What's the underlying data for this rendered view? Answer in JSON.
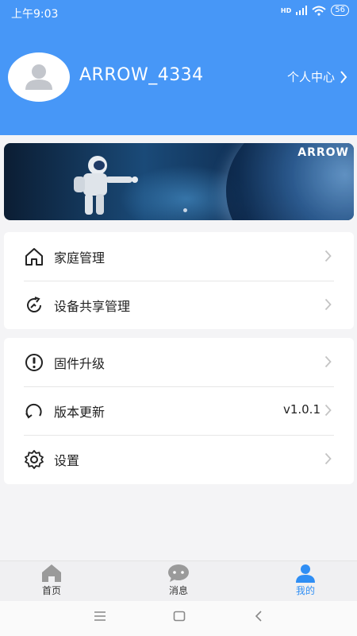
{
  "status_bar": {
    "time": "上午9:03",
    "network": "HD",
    "battery": "56"
  },
  "profile": {
    "username": "ARROW_4334",
    "center_link": "个人中心"
  },
  "banner": {
    "logo_text": "ARROW"
  },
  "menu_group_1": [
    {
      "label": "家庭管理",
      "icon": "home-icon"
    },
    {
      "label": "设备共享管理",
      "icon": "share-icon"
    }
  ],
  "menu_group_2": [
    {
      "label": "固件升级",
      "icon": "firmware-icon"
    },
    {
      "label": "版本更新",
      "icon": "update-icon",
      "value": "v1.0.1"
    },
    {
      "label": "设置",
      "icon": "gear-icon"
    }
  ],
  "tabs": [
    {
      "label": "首页",
      "icon": "home-tab-icon",
      "active": false
    },
    {
      "label": "消息",
      "icon": "message-icon",
      "active": false
    },
    {
      "label": "我的",
      "icon": "user-icon",
      "active": true
    }
  ],
  "colors": {
    "header": "#4797f7",
    "active_tab": "#2f8ef4",
    "inactive_icon": "#9a9a9a"
  }
}
